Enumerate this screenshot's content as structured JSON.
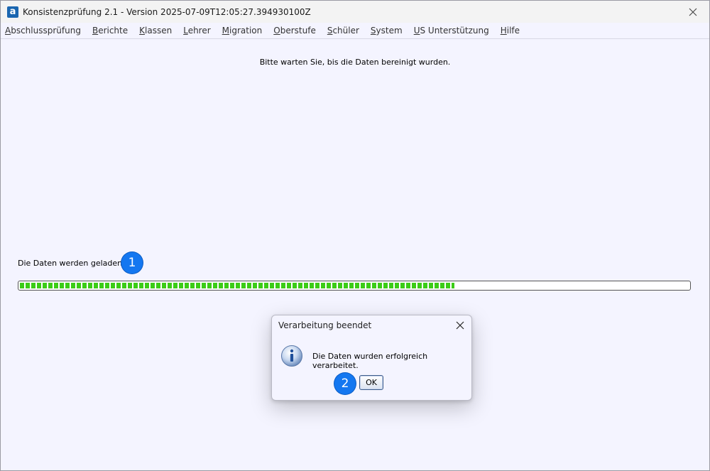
{
  "window": {
    "title": "Konsistenzprüfung 2.1 - Version 2025-07-09T12:05:27.394930100Z",
    "app_icon_letter": "a"
  },
  "menu": [
    {
      "first": "A",
      "rest": "bschlussprüfung"
    },
    {
      "first": "B",
      "rest": "erichte"
    },
    {
      "first": "K",
      "rest": "lassen"
    },
    {
      "first": "L",
      "rest": "ehrer"
    },
    {
      "first": "M",
      "rest": "igration"
    },
    {
      "first": "O",
      "rest": "berstufe"
    },
    {
      "first": "S",
      "rest": "chüler"
    },
    {
      "first": "S",
      "rest": "ystem"
    },
    {
      "first": "U",
      "rest": "S Unterstützung"
    },
    {
      "first": "H",
      "rest": "ilfe"
    }
  ],
  "main": {
    "wait_message": "Bitte warten Sie, bis die Daten bereinigt wurden.",
    "status_label": "Die Daten werden geladen.",
    "progress_fraction": 0.65
  },
  "badges": [
    "1",
    "2"
  ],
  "dialog": {
    "title": "Verarbeitung beendet",
    "message": "Die Daten wurden erfolgreich verarbeitet.",
    "ok_label": "OK",
    "icon": "info-icon"
  }
}
